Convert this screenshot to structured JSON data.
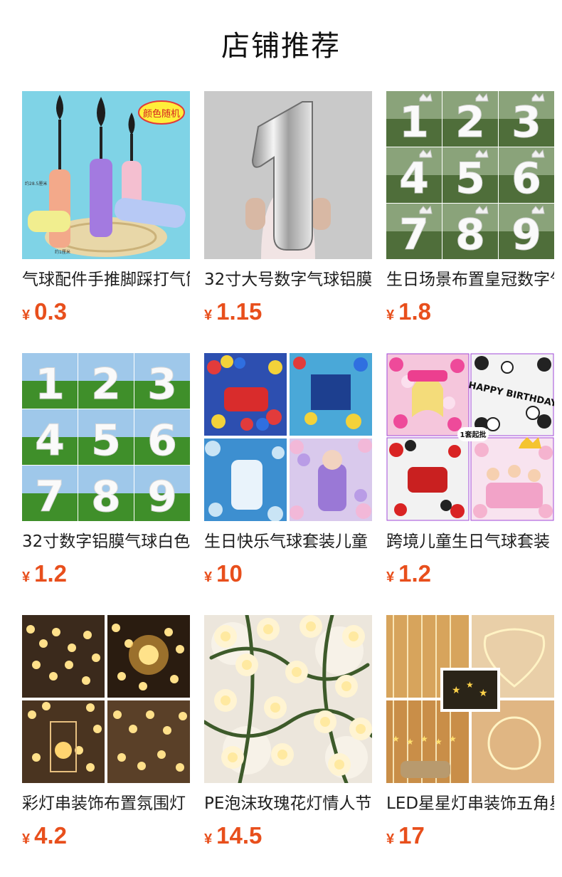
{
  "section": {
    "title": "店铺推荐"
  },
  "products": [
    {
      "name": "气球配件手推脚踩打气筒",
      "currency": "¥",
      "price": "0.3",
      "badge": "颜色随机",
      "dim1": "约28.5厘米",
      "dim2": "约1厘米"
    },
    {
      "name": "32寸大号数字气球铝膜",
      "currency": "¥",
      "price": "1.15",
      "digit": "1"
    },
    {
      "name": "生日场景布置皇冠数字气球",
      "currency": "¥",
      "price": "1.8",
      "digits": [
        "1",
        "2",
        "3",
        "4",
        "5",
        "6",
        "7",
        "8",
        "9"
      ]
    },
    {
      "name": "32寸数字铝膜气球白色",
      "currency": "¥",
      "price": "1.2",
      "digits": [
        "1",
        "2",
        "3",
        "4",
        "5",
        "6",
        "7",
        "8",
        "9"
      ]
    },
    {
      "name": "生日快乐气球套装儿童",
      "currency": "¥",
      "price": "10"
    },
    {
      "name": "跨境儿童生日气球套装",
      "currency": "¥",
      "price": "1.2",
      "label": "1套起批",
      "banner": "HAPPY BIRTHDAY"
    },
    {
      "name": "彩灯串装饰布置氛围灯",
      "currency": "¥",
      "price": "4.2"
    },
    {
      "name": "PE泡沫玫瑰花灯情人节",
      "currency": "¥",
      "price": "14.5"
    },
    {
      "name": "LED星星灯串装饰五角星",
      "currency": "¥",
      "price": "17"
    }
  ],
  "colors": {
    "price": "#e84f1c",
    "title": "#111111"
  }
}
